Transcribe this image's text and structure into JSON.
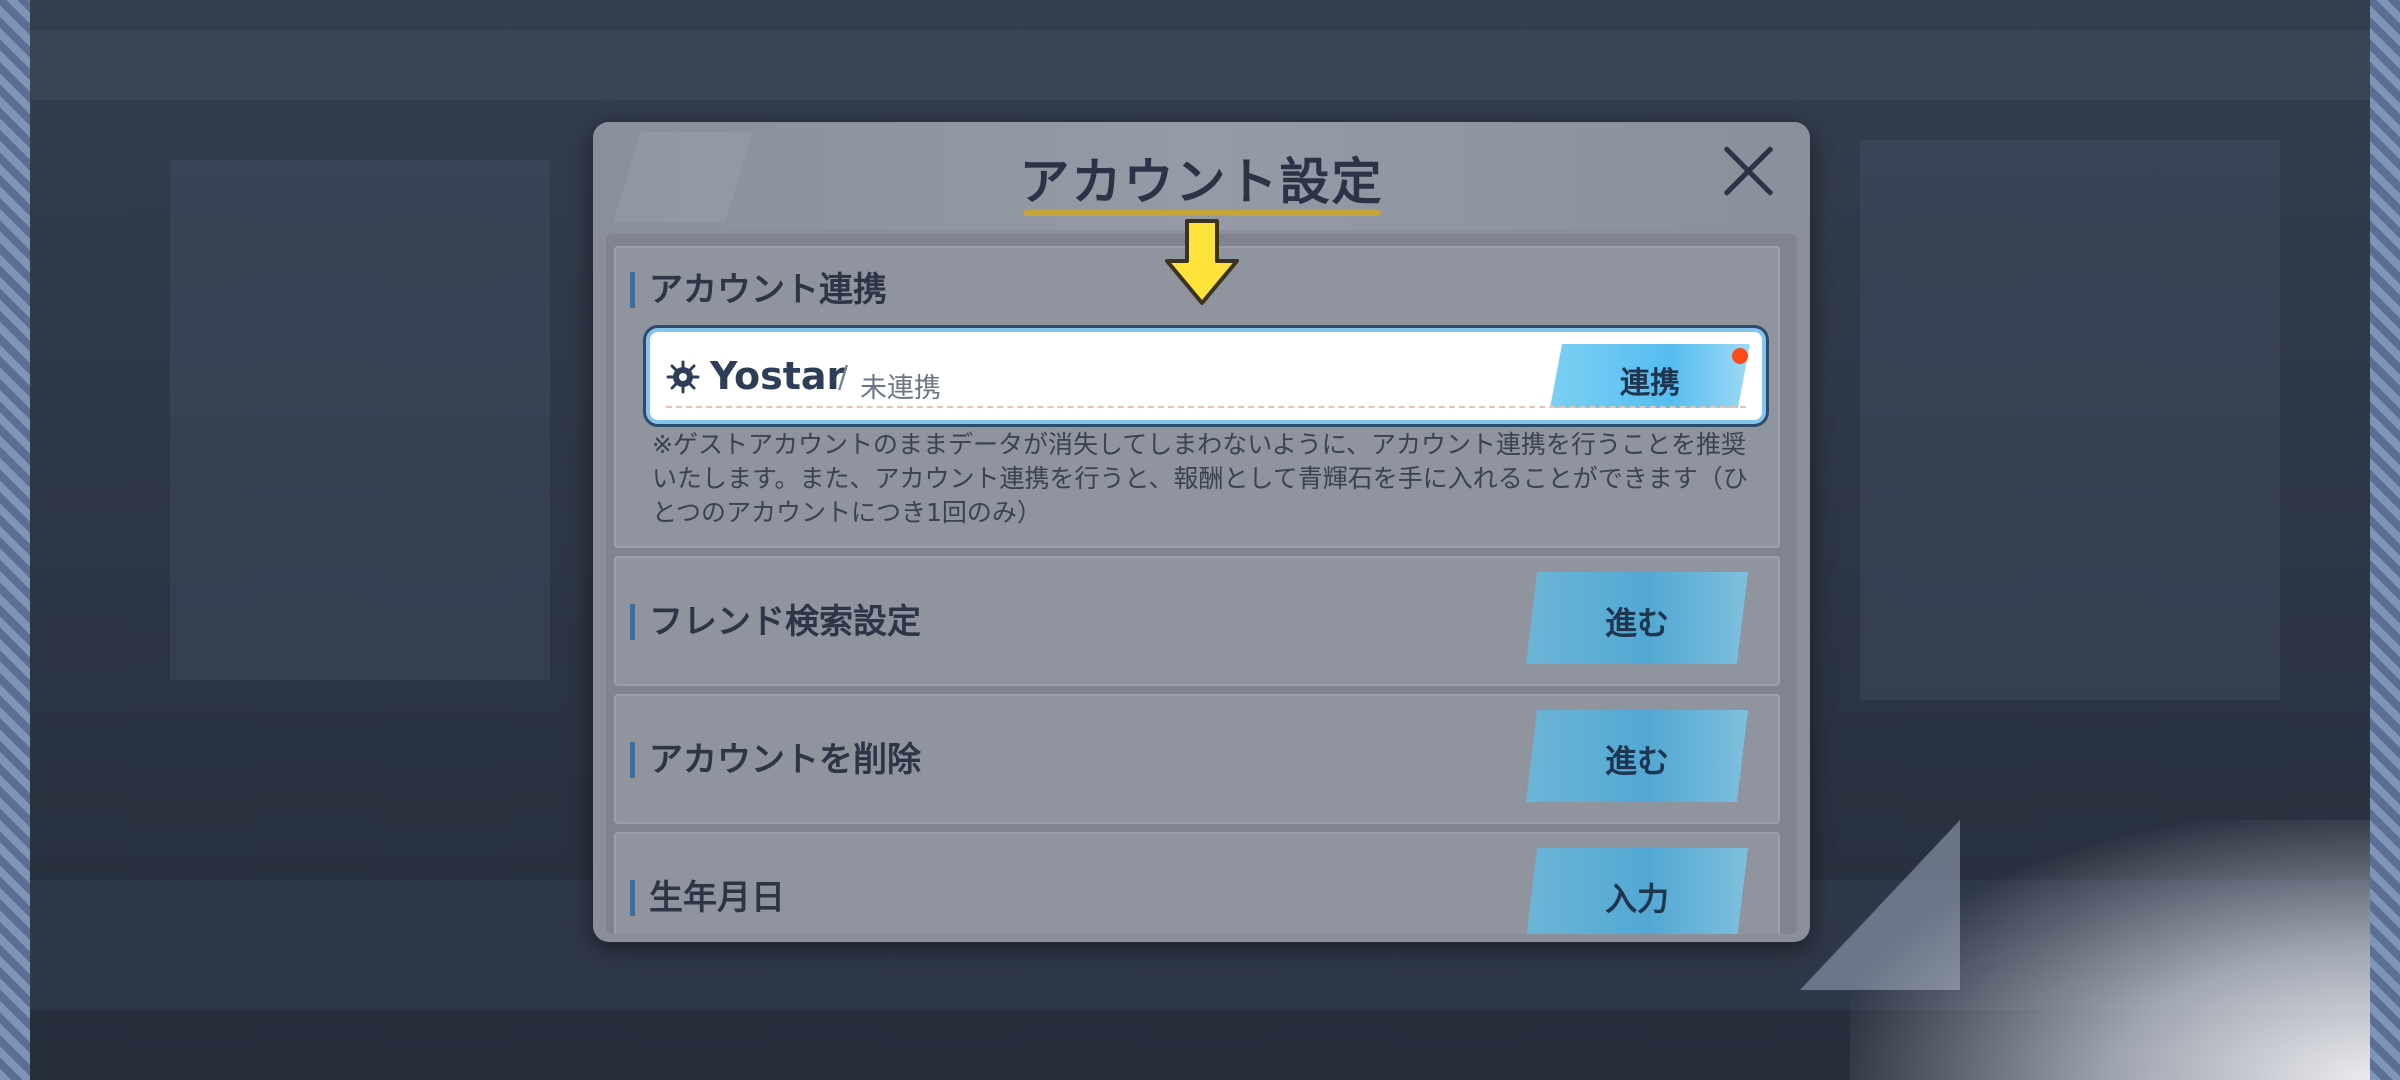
{
  "dialog": {
    "title": "アカウント設定",
    "close_icon": "close-icon"
  },
  "sections": {
    "account_link": {
      "label": "アカウント連携",
      "service_name": "Yostar",
      "separator": "/",
      "status": "未連携",
      "button_label": "連携",
      "note": "※ゲストアカウントのままデータが消失してしまわないように、アカウント連携を行うことを推奨いたします。また、アカウント連携を行うと、報酬として青輝石を手に入れることができます（ひとつのアカウントにつき1回のみ）"
    },
    "friend_search": {
      "label": "フレンド検索設定",
      "button_label": "進む"
    },
    "delete_account": {
      "label": "アカウントを削除",
      "button_label": "進む"
    },
    "birthday": {
      "label": "生年月日",
      "button_label": "入力"
    }
  },
  "colors": {
    "title_underline": "#c5a43a",
    "button_blue": "#56bdf0",
    "notify_dot": "#ff4a1a",
    "arrow_yellow": "#ffe23a"
  }
}
